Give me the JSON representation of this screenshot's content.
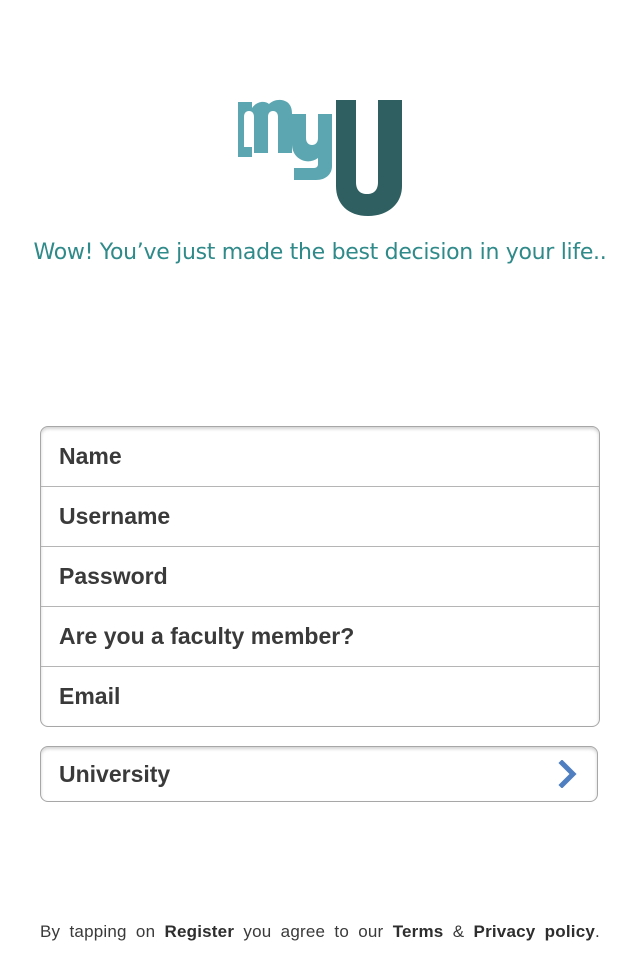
{
  "app": {
    "logo_name": "myU-logo",
    "colors": {
      "logo_light": "#5ba6b1",
      "logo_dark": "#2f5f61",
      "tagline": "#2f8a89",
      "chevron": "#4f7fc0"
    }
  },
  "header": {
    "tagline": "Wow! You’ve just made the best decision in your life.."
  },
  "form": {
    "fields": [
      {
        "placeholder": "Name",
        "value": ""
      },
      {
        "placeholder": "Username",
        "value": ""
      },
      {
        "placeholder": "Password",
        "value": ""
      },
      {
        "placeholder": "Are you a faculty member?",
        "value": ""
      },
      {
        "placeholder": "Email",
        "value": ""
      }
    ],
    "university": {
      "label": "University",
      "icon": "chevron-right-icon"
    }
  },
  "footer": {
    "prefix": "By tapping on",
    "register": "Register",
    "middle": "you agree to our",
    "terms": "Terms",
    "amp": "&",
    "privacy": "Privacy policy",
    "suffix": "."
  }
}
